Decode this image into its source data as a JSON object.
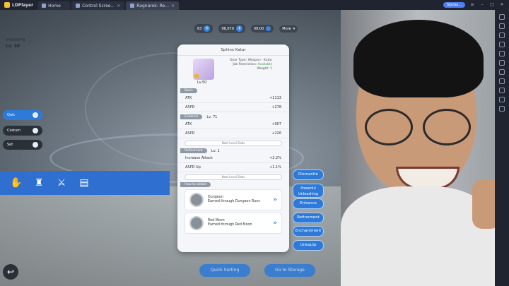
{
  "titlebar": {
    "app_name": "LDPlayer",
    "tabs": [
      {
        "label": "Home"
      },
      {
        "label": "Control Scree..."
      },
      {
        "label": "Ragnarok: Re..."
      }
    ],
    "account_label": "Sjozaa..."
  },
  "resources": [
    {
      "value": "83"
    },
    {
      "value": "96,070"
    },
    {
      "value": "09:00"
    },
    {
      "value": "More"
    }
  ],
  "left_panel": {
    "label": "myaccking",
    "level": "Lv. 30",
    "mode_buttons": [
      {
        "label": "Quic"
      },
      {
        "label": "Costum"
      },
      {
        "label": "Set"
      }
    ]
  },
  "card": {
    "title": "Sphinx Katar",
    "item_level": "Lv.50",
    "gear_type": "Gear Type: Weapon · Katar",
    "job_restriction_label": "Job Restriction:",
    "job_restriction_value": "Available",
    "weight": "Weight: 1",
    "base_label": "Basic",
    "base_stats": [
      {
        "name": "ATK",
        "value": "+1113"
      },
      {
        "name": "ASPD",
        "value": "+278"
      }
    ],
    "enhance_label": "Enhance",
    "enhance_level": "Lv. 71",
    "enhance_stats": [
      {
        "name": "ATK",
        "value": "+907"
      },
      {
        "name": "ASPD",
        "value": "+226"
      }
    ],
    "next_level": "Next Level Stats",
    "refine_label": "Refinement",
    "refine_level": "Lv. 1",
    "refine_stats": [
      {
        "name": "Increase Attack",
        "value": "+2.2%"
      },
      {
        "name": "ASPD Up",
        "value": "+1.1%"
      }
    ],
    "how_label": "How to obtain",
    "sources": [
      {
        "name": "Dungeon",
        "desc": "Earned through Dungeon Runs"
      },
      {
        "name": "Red Moon",
        "desc": "Earned through Red Moon"
      }
    ]
  },
  "side_actions": [
    {
      "label": "Dismantle"
    },
    {
      "label": "Powerful Unleashing"
    },
    {
      "label": "Enhance"
    },
    {
      "label": "Refinement"
    },
    {
      "label": "Enchantment"
    },
    {
      "label": "Unequip"
    }
  ],
  "bottom": {
    "quick_sorting": "Quick Sorting",
    "go_to_storage": "Go to Storage"
  },
  "colors": {
    "accent": "#2d7ad8",
    "card_bg": "#f4f6f9",
    "titlebar": "#1f2430"
  }
}
